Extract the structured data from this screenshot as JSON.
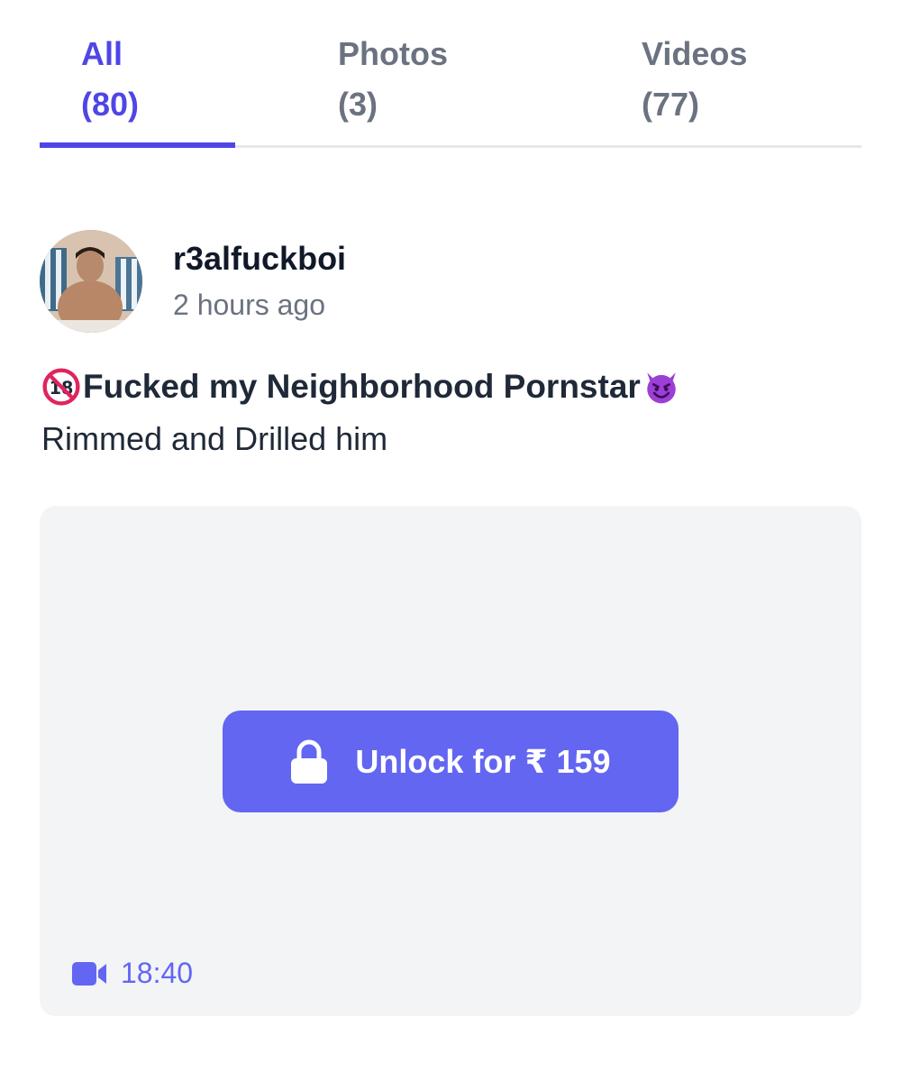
{
  "tabs": [
    {
      "name": "All",
      "count": "(80)",
      "active": true
    },
    {
      "name": "Photos",
      "count": "(3)",
      "active": false
    },
    {
      "name": "Videos",
      "count": "(77)",
      "active": false
    }
  ],
  "post": {
    "username": "r3alfuckboi",
    "timestamp": "2 hours ago",
    "caption_title": "Fucked my Neighborhood Pornstar",
    "caption_body": "Rimmed and Drilled him",
    "caption_prefix_icon": "no-under-18-icon",
    "caption_suffix_icon": "smiling-devil-icon"
  },
  "media": {
    "unlock_label": "Unlock for ₹ 159",
    "duration": "18:40",
    "media_type_icon": "video-camera-icon"
  },
  "colors": {
    "accent": "#4f46e5",
    "button": "#6366f1",
    "muted_text": "#6b7280",
    "card_bg": "#f3f4f6"
  }
}
